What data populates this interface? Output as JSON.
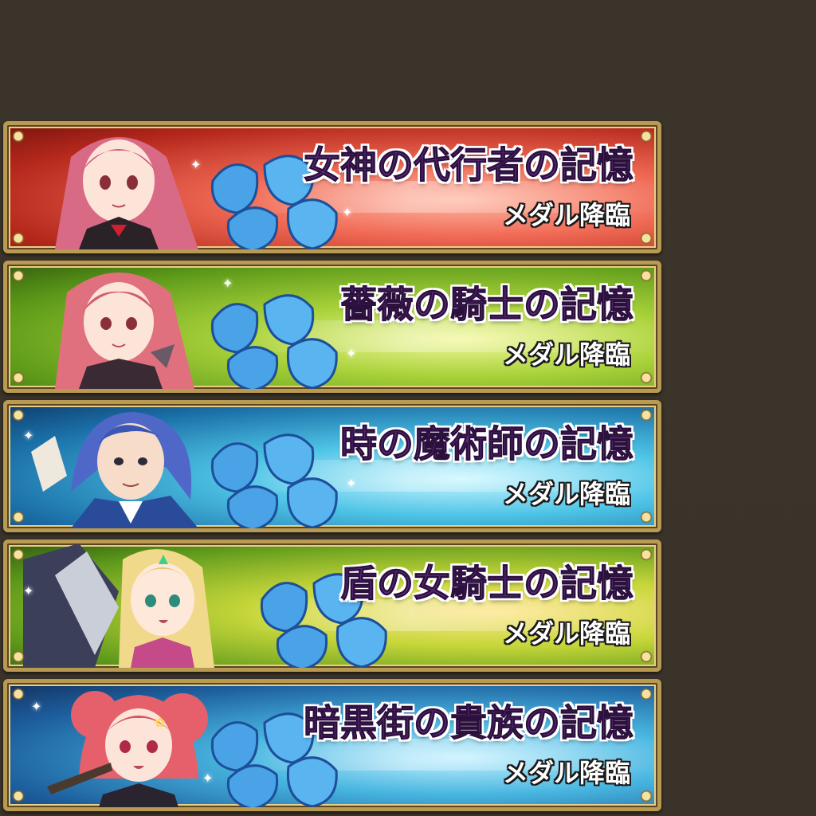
{
  "banners": [
    {
      "title": "女神の代行者の記憶",
      "subtitle": "メダル降臨",
      "theme": "red",
      "hair_color": "#d96a86",
      "outfit_color": "#2a2226"
    },
    {
      "title": "薔薇の騎士の記憶",
      "subtitle": "メダル降臨",
      "theme": "green",
      "hair_color": "#e0707e",
      "outfit_color": "#3a2a33"
    },
    {
      "title": "時の魔術師の記憶",
      "subtitle": "メダル降臨",
      "theme": "blue",
      "hair_color": "#4f68c8",
      "outfit_color": "#2a4a9a"
    },
    {
      "title": "盾の女騎士の記憶",
      "subtitle": "メダル降臨",
      "theme": "lime",
      "hair_color": "#f0d98a",
      "outfit_color": "#3c3f5a"
    },
    {
      "title": "暗黒街の貴族の記憶",
      "subtitle": "メダル降臨",
      "theme": "cyan",
      "hair_color": "#e5606a",
      "outfit_color": "#2a2430"
    }
  ],
  "colors": {
    "frame_gold": "#b89a52",
    "title_purple": "#5a2a7a",
    "medal_blue": "#4aa3e6",
    "background": "#3a3329"
  },
  "icons": {
    "medal": "blue-medal-icon",
    "sparkle": "sparkle-icon"
  }
}
